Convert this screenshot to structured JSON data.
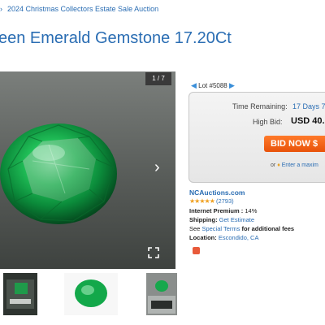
{
  "breadcrumb": {
    "separator": "›",
    "text": "2024 Christmas Collectors Estate Sale Auction"
  },
  "page_title": "een Emerald Gemstone 17.20Ct",
  "gallery": {
    "counter": "1 / 7"
  },
  "lot": {
    "label": "Lot #5088"
  },
  "bid_box": {
    "time_label": "Time Remaining:",
    "time_value": "17 Days 7",
    "high_bid_label": "High Bid:",
    "high_bid_value": "USD 40.",
    "bid_button": "BID NOW $",
    "or_text": "or",
    "max_link": "Enter a maxim"
  },
  "seller": {
    "name": "NCAuctions.com",
    "stars": "★★★★★",
    "rating_count": "(2793)",
    "premium_label": "Internet Premium :",
    "premium_value": "14%",
    "shipping_label": "Shipping:",
    "shipping_value": "Get Estimate",
    "see_text": "See",
    "terms_link": "Special Terms",
    "terms_suffix": "for additional fees",
    "location_label": "Location:",
    "location_value": "Escondido, CA"
  },
  "colors": {
    "link": "#2a6db3",
    "accent": "#e8520a",
    "emerald": "#12a84a"
  }
}
